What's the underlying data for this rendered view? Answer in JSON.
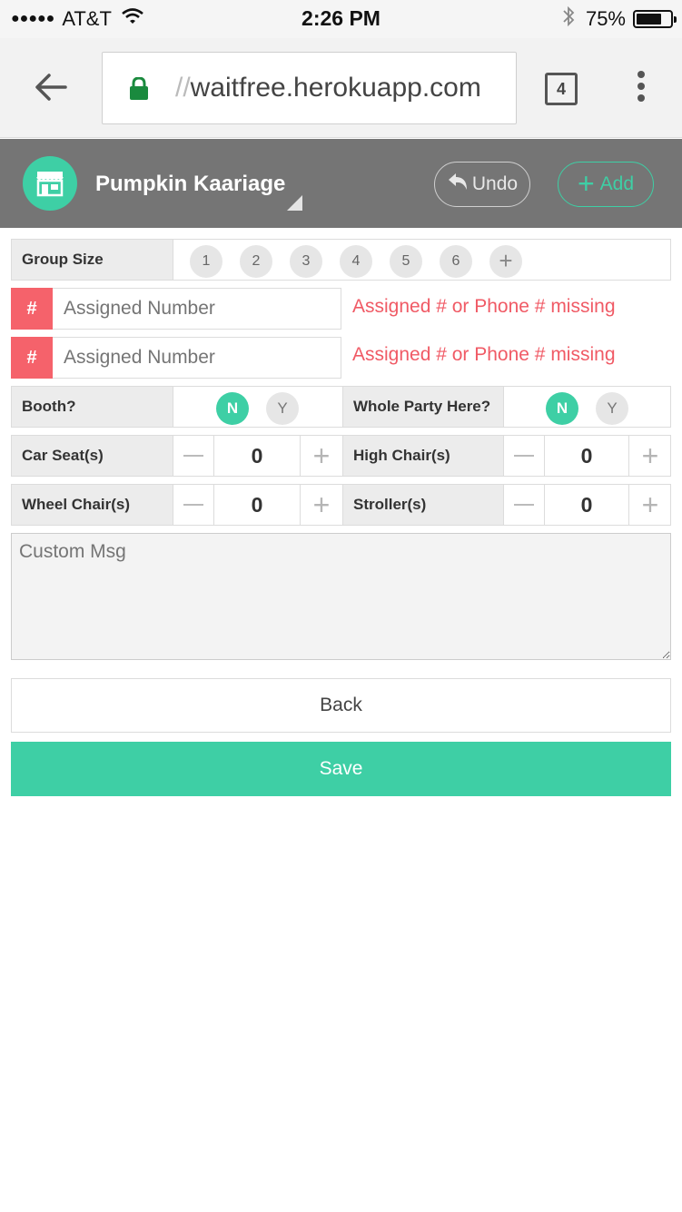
{
  "status_bar": {
    "carrier": "AT&T",
    "time": "2:26 PM",
    "battery": "75%",
    "battery_level": 0.75,
    "signal_icon": "signal-dots-icon",
    "wifi_icon": "wifi-icon",
    "bluetooth_icon": "bluetooth-icon"
  },
  "browser": {
    "url_prefix": "//",
    "url": "waitfree.herokuapp.com",
    "tab_count": "4",
    "lock_color": "#1a8a3e"
  },
  "header": {
    "store_name": "Pumpkin Kaariage",
    "undo_label": "Undo",
    "add_label": "Add",
    "brand_color": "#3ecfa5"
  },
  "form": {
    "group_size": {
      "label": "Group Size",
      "options": [
        "1",
        "2",
        "3",
        "4",
        "5",
        "6",
        "+"
      ]
    },
    "assigned_numbers": [
      {
        "prefix": "#",
        "placeholder": "Assigned Number",
        "value": "",
        "error": "Assigned # or Phone # missing"
      },
      {
        "prefix": "#",
        "placeholder": "Assigned Number",
        "value": "",
        "error": "Assigned # or Phone # missing"
      }
    ],
    "booth": {
      "label": "Booth?",
      "selected": "N",
      "options": [
        "N",
        "Y"
      ]
    },
    "whole_party": {
      "label": "Whole Party Here?",
      "selected": "N",
      "options": [
        "N",
        "Y"
      ]
    },
    "car_seats": {
      "label": "Car Seat(s)",
      "value": "0"
    },
    "high_chairs": {
      "label": "High Chair(s)",
      "value": "0"
    },
    "wheel_chairs": {
      "label": "Wheel Chair(s)",
      "value": "0"
    },
    "strollers": {
      "label": "Stroller(s)",
      "value": "0"
    },
    "custom_msg": {
      "placeholder": "Custom Msg",
      "value": ""
    },
    "back_label": "Back",
    "save_label": "Save",
    "error_color": "#f05a65"
  }
}
